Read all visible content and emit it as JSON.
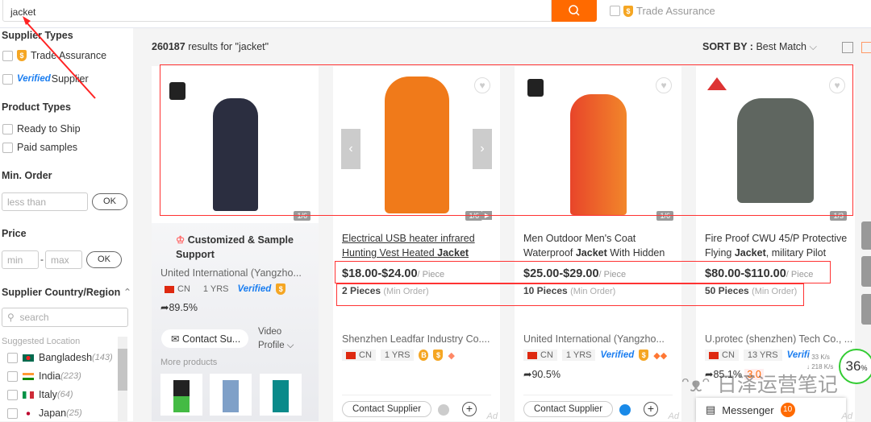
{
  "search": {
    "value": "jacket",
    "trade_assurance": "Trade Assurance"
  },
  "sidebar": {
    "supplier_types": "Supplier Types",
    "trade_assurance": "Trade Assurance",
    "verified": "Verified",
    "supplier": "Supplier",
    "product_types": "Product Types",
    "ready_to_ship": "Ready to Ship",
    "paid_samples": "Paid samples",
    "min_order": "Min. Order",
    "less_than": "less than",
    "ok": "OK",
    "price": "Price",
    "min": "min",
    "max": "max",
    "dash": "-",
    "country": "Supplier Country/Region",
    "country_search": "search",
    "suggested": "Suggested Location",
    "locations": [
      {
        "name": "Bangladesh",
        "count": "(143)"
      },
      {
        "name": "India",
        "count": "(223)"
      },
      {
        "name": "Italy",
        "count": "(64)"
      },
      {
        "name": "Japan",
        "count": "(25)"
      }
    ]
  },
  "results": {
    "count": "260187",
    "text": " results for \"jacket\"",
    "sort_label": "SORT BY :",
    "sort_value": "Best Match"
  },
  "cards": [
    {
      "counter": "1/6",
      "feature": "Customized & Sample Support",
      "supplier": "United International (Yangzho...",
      "country": "CN",
      "years": "1 YRS",
      "verified": "Verified",
      "rate": "89.5%",
      "contact": "Contact Su...",
      "video": "Video",
      "profile": "Profile",
      "more": "More products"
    },
    {
      "counter": "1/6",
      "title_pre": "Electrical USB heater infrared Hunting Vest Heated ",
      "title_bold": "Jacket",
      "title_post": "",
      "price": "$18.00-$24.00",
      "unit": "/ Piece",
      "moq": "2 Pieces",
      "moq_note": "(Min Order)",
      "supplier": "Shenzhen Leadfar Industry Co....",
      "country": "CN",
      "years": "1 YRS",
      "contact": "Contact Supplier",
      "ad": "Ad"
    },
    {
      "counter": "1/6",
      "title_pre": "Men Outdoor Men's Coat Waterproof ",
      "title_bold": "Jacket",
      "title_post": " With Hidden",
      "price": "$25.00-$29.00",
      "unit": "/ Piece",
      "moq": "10 Pieces",
      "moq_note": "(Min Order)",
      "supplier": "United International (Yangzho...",
      "country": "CN",
      "years": "1 YRS",
      "verified": "Verified",
      "rate": "90.5%",
      "contact": "Contact Supplier",
      "ad": "Ad"
    },
    {
      "counter": "1/3",
      "brand": "U.PROTEC",
      "title_pre": "Fire Proof CWU 45/P Protective Flying ",
      "title_bold": "Jacket",
      "title_post": ", military Pilot",
      "price": "$80.00-$110.00",
      "unit": "/ Piece",
      "moq": "50 Pieces",
      "moq_note": "(Min Order)",
      "supplier": "U.protec (shenzhen) Tech Co., ...",
      "country": "CN",
      "years": "13 YRS",
      "verified": "Verifi",
      "rate": "85.1%",
      "score": "3.0",
      "messenger": "Messenger",
      "messenger_count": "10",
      "ad": "Ad"
    }
  ],
  "overlay": {
    "up": "↑ 33 K/s",
    "down": "↓ 218 K/s",
    "percent": "36",
    "pct_sign": "%",
    "watermark": "日泽运营笔记"
  },
  "colors": {
    "accent": "#ff6a00",
    "annotation": "#ff3333",
    "verified": "#1a7df0"
  }
}
